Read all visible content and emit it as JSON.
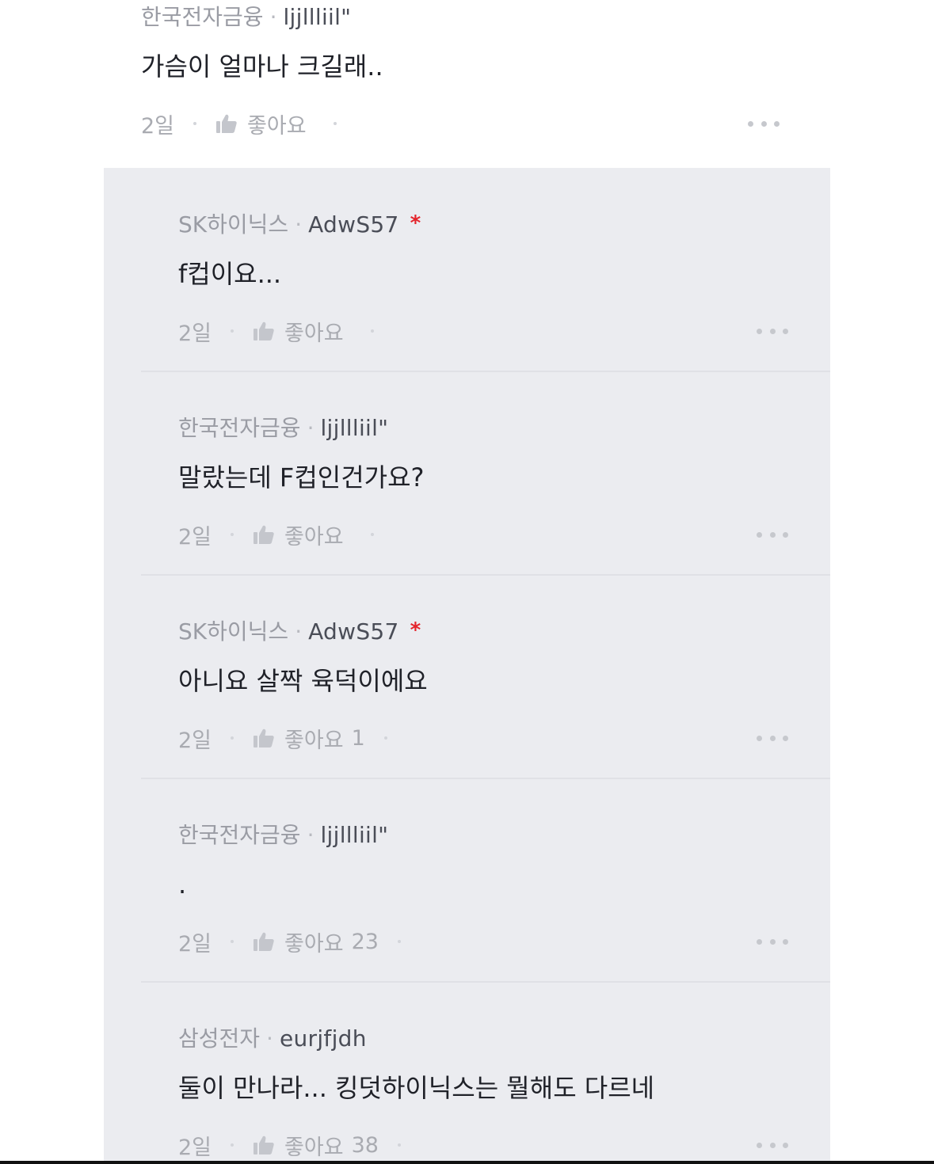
{
  "comments": [
    {
      "company": "한국전자금융",
      "separator": "·",
      "nickname": "ljjllliil\"",
      "author_mark": "",
      "body": "가슴이 얼마나 크길래..",
      "time": "2일",
      "like_label": "좋아요",
      "like_count": ""
    }
  ],
  "replies": [
    {
      "company": "SK하이닉스",
      "separator": "·",
      "nickname": "AdwS57",
      "author_mark": "*",
      "body": "f컵이요...",
      "time": "2일",
      "like_label": "좋아요",
      "like_count": ""
    },
    {
      "company": "한국전자금융",
      "separator": "·",
      "nickname": "ljjllliil\"",
      "author_mark": "",
      "body": "말랐는데 F컵인건가요?",
      "time": "2일",
      "like_label": "좋아요",
      "like_count": ""
    },
    {
      "company": "SK하이닉스",
      "separator": "·",
      "nickname": "AdwS57",
      "author_mark": "*",
      "body": "아니요 살짝 육덕이에요",
      "time": "2일",
      "like_label": "좋아요",
      "like_count": "1"
    },
    {
      "company": "한국전자금융",
      "separator": "·",
      "nickname": "ljjllliil\"",
      "author_mark": "",
      "body": ".",
      "time": "2일",
      "like_label": "좋아요",
      "like_count": "23"
    },
    {
      "company": "삼성전자",
      "separator": "·",
      "nickname": "eurjfjdh",
      "author_mark": "",
      "body": "둘이 만나라... 킹덧하이닉스는 뭘해도 다르네",
      "time": "2일",
      "like_label": "좋아요",
      "like_count": "38"
    }
  ],
  "icons": {
    "like": "thumbs-up-icon",
    "more": "more-options-icon"
  },
  "colors": {
    "reply_background": "#ebecf0",
    "author_mark": "#e4242c",
    "meta_text": "#9a9ca4",
    "body_text": "#1f2128"
  }
}
